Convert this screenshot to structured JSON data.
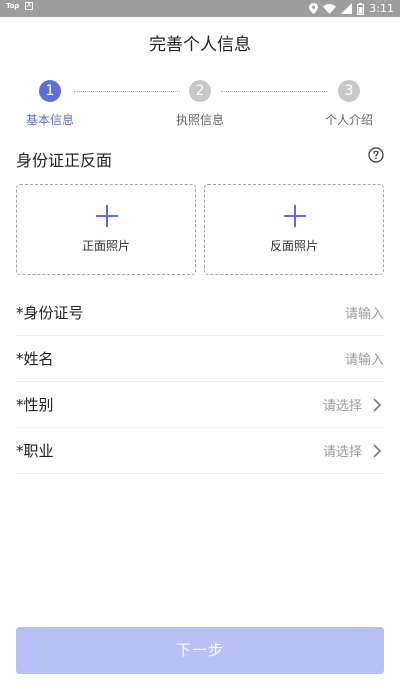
{
  "status_bar": {
    "left_text": "Top",
    "left_badge": "A",
    "time": "3:11"
  },
  "header": {
    "title": "完善个人信息"
  },
  "steps": [
    {
      "number": "1",
      "label": "基本信息",
      "active": true
    },
    {
      "number": "2",
      "label": "执照信息",
      "active": false
    },
    {
      "number": "3",
      "label": "个人介绍",
      "active": false
    }
  ],
  "id_section": {
    "title": "身份证正反面",
    "front_label": "正面照片",
    "back_label": "反面照片"
  },
  "form": {
    "id_number": {
      "label": "*身份证号",
      "placeholder": "请输入"
    },
    "name": {
      "label": "*姓名",
      "placeholder": "请输入"
    },
    "gender": {
      "label": "*性别",
      "placeholder": "请选择"
    },
    "occupation": {
      "label": "*职业",
      "placeholder": "请选择"
    }
  },
  "footer": {
    "next_label": "下一步"
  },
  "colors": {
    "accent": "#5b6fd6",
    "inactive_step": "#c8c8c8",
    "button_disabled": "#b8c1f6"
  }
}
